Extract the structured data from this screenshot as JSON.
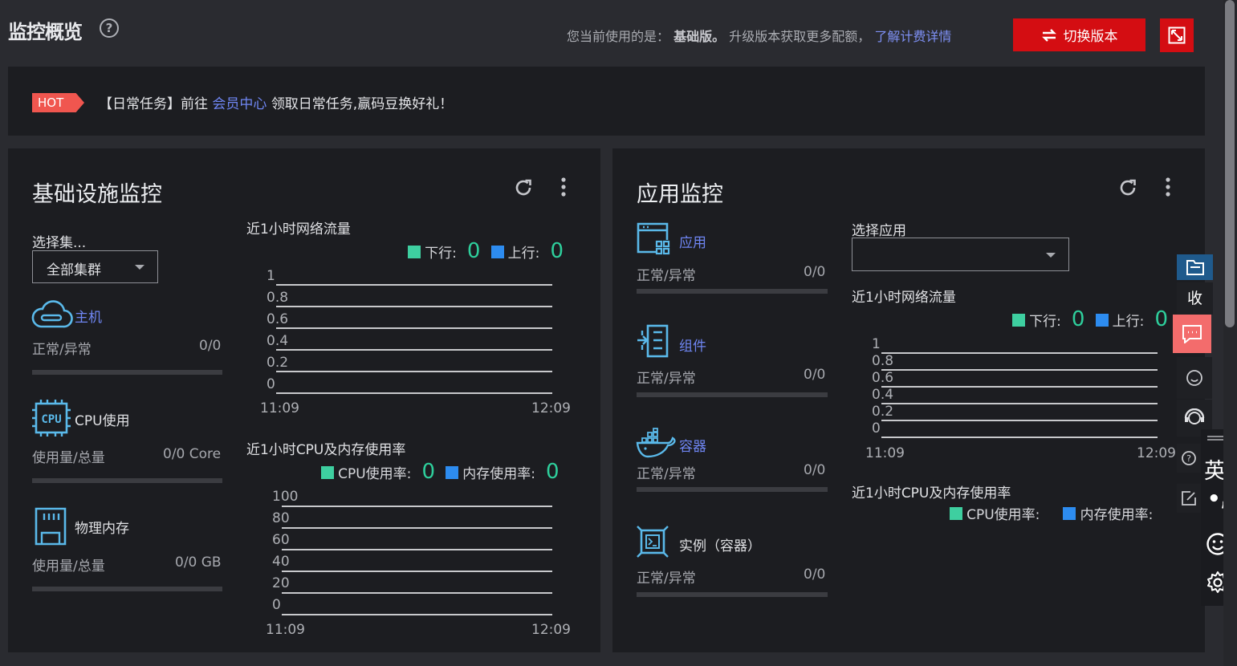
{
  "header": {
    "title": "监控概览",
    "help_icon": "help-circle-icon",
    "version_prefix": "您当前使用的是：",
    "version_name": "基础版。",
    "version_suffix": "升级版本获取更多配额，",
    "pricing_link": "了解计费详情",
    "switch_button": "切换版本",
    "expand_icon": "expand-icon",
    "brand_color": "#d40d12"
  },
  "banner": {
    "tag": "HOT",
    "prefix": "【日常任务】前往",
    "link": "会员中心",
    "suffix": "领取日常任务,赢码豆换好礼！"
  },
  "infra": {
    "title": "基础设施监控",
    "refresh_icon": "refresh-icon",
    "more_icon": "more-vertical-icon",
    "cluster_label": "选择集...",
    "cluster_value": "全部集群",
    "host": {
      "label": "主机",
      "sub": "正常/异常",
      "value": "0/0"
    },
    "cpu": {
      "label": "CPU使用",
      "sub": "使用量/总量",
      "value": "0/0 Core"
    },
    "memory": {
      "label": "物理内存",
      "sub": "使用量/总量",
      "value": "0/0 GB"
    },
    "network": {
      "title": "近1小时网络流量",
      "down_label": "下行:",
      "down_value": "0",
      "up_label": "上行:",
      "up_value": "0",
      "y_ticks": [
        "1",
        "0.8",
        "0.6",
        "0.4",
        "0.2",
        "0"
      ],
      "x_start": "11:09",
      "x_end": "12:09"
    },
    "cpu_mem": {
      "title": "近1小时CPU及内存使用率",
      "cpu_label": "CPU使用率:",
      "cpu_value": "0",
      "mem_label": "内存使用率:",
      "mem_value": "0",
      "y_ticks": [
        "100",
        "80",
        "60",
        "40",
        "20",
        "0"
      ],
      "x_start": "11:09",
      "x_end": "12:09"
    }
  },
  "app": {
    "title": "应用监控",
    "refresh_icon": "refresh-icon",
    "more_icon": "more-vertical-icon",
    "items": [
      {
        "label": "应用",
        "sub": "正常/异常",
        "value": "0/0"
      },
      {
        "label": "组件",
        "sub": "正常/异常",
        "value": "0/0"
      },
      {
        "label": "容器",
        "sub": "正常/异常",
        "value": "0/0"
      },
      {
        "label": "实例（容器）",
        "sub": "正常/异常",
        "value": "0/0"
      }
    ],
    "select_label": "选择应用",
    "select_value": "",
    "network": {
      "title": "近1小时网络流量",
      "down_label": "下行:",
      "down_value": "0",
      "up_label": "上行:",
      "up_value": "0",
      "y_ticks": [
        "1",
        "0.8",
        "0.6",
        "0.4",
        "0.2",
        "0"
      ],
      "x_start": "11:09",
      "x_end": "12:09"
    },
    "cpu_mem": {
      "title": "近1小时CPU及内存使用率",
      "cpu_label": "CPU使用率:",
      "mem_label": "内存使用率:"
    }
  },
  "side_tools": {
    "collapse_label": "收",
    "ime_lang": "英",
    "ime_punct": "•,"
  },
  "colors": {
    "green": "#2ecf9c",
    "down_legend": "#3ecfa0",
    "up_legend": "#2d8cf0",
    "accent_red": "#d40d12",
    "link_blue": "#6f86f3"
  }
}
